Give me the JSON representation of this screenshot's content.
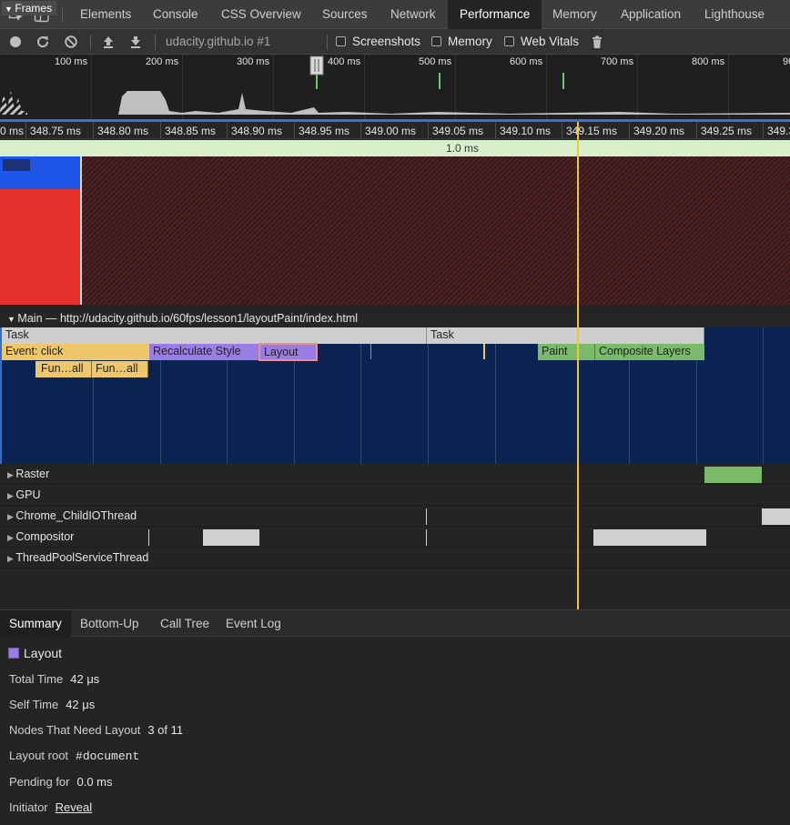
{
  "tabs": [
    {
      "label": "Elements"
    },
    {
      "label": "Console"
    },
    {
      "label": "CSS Overview"
    },
    {
      "label": "Sources"
    },
    {
      "label": "Network"
    },
    {
      "label": "Performance"
    },
    {
      "label": "Memory"
    },
    {
      "label": "Application"
    },
    {
      "label": "Lighthouse"
    }
  ],
  "active_tab": "Performance",
  "toolbar": {
    "recording_target": "udacity.github.io #1",
    "screenshots_label": "Screenshots",
    "memory_label": "Memory",
    "web_vitals_label": "Web Vitals",
    "screenshots_checked": false,
    "memory_checked": false,
    "web_vitals_checked": false
  },
  "overview_ticks": [
    "100 ms",
    "200 ms",
    "300 ms",
    "400 ms",
    "500 ms",
    "600 ms",
    "700 ms",
    "800 ms",
    "90"
  ],
  "ruler_ticks": [
    "0 ms",
    "348.75 ms",
    "348.80 ms",
    "348.85 ms",
    "348.90 ms",
    "348.95 ms",
    "349.00 ms",
    "349.05 ms",
    "349.10 ms",
    "349.15 ms",
    "349.20 ms",
    "349.25 ms",
    "349.3"
  ],
  "frames": {
    "label": "Frames",
    "duration": "1.0 ms"
  },
  "main": {
    "title": "Main — http://udacity.github.io/60fps/lesson1/layoutPaint/index.html",
    "events": {
      "task1": "Task",
      "task2": "Task",
      "click": "Event: click",
      "recalc": "Recalculate Style",
      "layout": "Layout",
      "paint": "Paint",
      "composite": "Composite Layers",
      "fun1": "Fun…all",
      "fun2": "Fun…all"
    }
  },
  "threads": [
    {
      "label": "Raster"
    },
    {
      "label": "GPU"
    },
    {
      "label": "Chrome_ChildIOThread"
    },
    {
      "label": "Compositor"
    },
    {
      "label": "ThreadPoolServiceThread"
    }
  ],
  "bottom_tabs": [
    {
      "label": "Summary"
    },
    {
      "label": "Bottom-Up"
    },
    {
      "label": "Call Tree"
    },
    {
      "label": "Event Log"
    }
  ],
  "summary": {
    "title": "Layout",
    "color": "#9a7de4",
    "rows": {
      "total_time_label": "Total Time",
      "total_time": "42 μs",
      "self_time_label": "Self Time",
      "self_time": "42 μs",
      "nodes_label": "Nodes That Need Layout",
      "nodes": "3 of 11",
      "root_label": "Layout root",
      "root": "#document",
      "pending_label": "Pending for",
      "pending": "0.0 ms",
      "initiator_label": "Initiator",
      "initiator": "Reveal"
    }
  },
  "colors": {
    "scripting": "#eec76b",
    "rendering": "#9a7de4",
    "painting": "#7bb96b",
    "cursor": "#f4c52c"
  }
}
